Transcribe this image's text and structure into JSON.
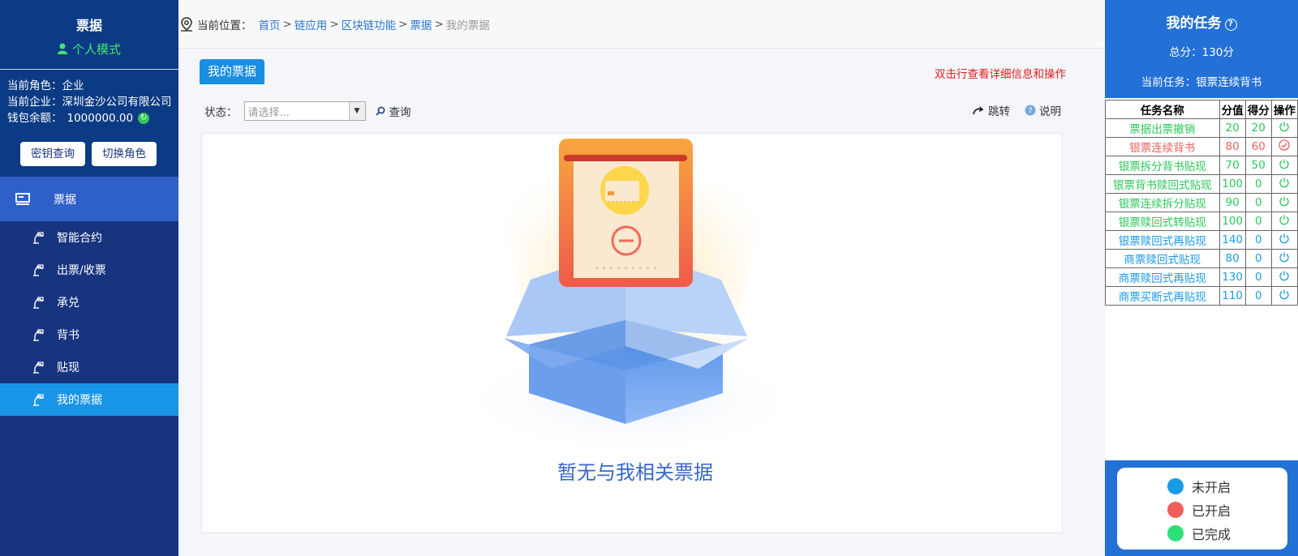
{
  "sidebar": {
    "title": "票据",
    "mode": "个人模式",
    "role_label": "当前角色：",
    "role_value": "企业",
    "company_label": "当前企业：",
    "company_value": "深圳金沙公司有限公司",
    "wallet_label": "钱包余额：",
    "wallet_value": "1000000.00",
    "key_button": "密钥查询",
    "switch_button": "切换角色",
    "menu_head": "票据",
    "items": [
      {
        "label": "智能合约",
        "active": false
      },
      {
        "label": "出票/收票",
        "active": false
      },
      {
        "label": "承兑",
        "active": false
      },
      {
        "label": "背书",
        "active": false
      },
      {
        "label": "贴现",
        "active": false
      },
      {
        "label": "我的票据",
        "active": true
      }
    ]
  },
  "breadcrumb": {
    "label": "当前位置：",
    "links": [
      "首页",
      "链应用",
      "区块链功能",
      "票据"
    ],
    "current": "我的票据"
  },
  "content": {
    "tab": "我的票据",
    "hint": "双击行查看详细信息和操作",
    "status_label": "状态：",
    "status_placeholder": "请选择...",
    "query_label": "查询",
    "jump_label": "跳转",
    "help_label": "说明",
    "empty_text": "暂无与我相关票据"
  },
  "tasks": {
    "title": "我的任务",
    "score": "总分：130分",
    "current": "当前任务：银票连续背书",
    "headers": [
      "任务名称",
      "分值",
      "得分",
      "操作"
    ],
    "rows": [
      {
        "name": "票据出票撤销",
        "value": "20",
        "score": "20",
        "status": "done"
      },
      {
        "name": "银票连续背书",
        "value": "80",
        "score": "60",
        "status": "started"
      },
      {
        "name": "银票拆分背书贴现",
        "value": "70",
        "score": "50",
        "status": "done"
      },
      {
        "name": "银票背书赎回式贴现",
        "value": "100",
        "score": "0",
        "status": "done"
      },
      {
        "name": "银票连续拆分贴现",
        "value": "90",
        "score": "0",
        "status": "done"
      },
      {
        "name": "银票赎回式转贴现",
        "value": "100",
        "score": "0",
        "status": "done"
      },
      {
        "name": "银票赎回式再贴现",
        "value": "140",
        "score": "0",
        "status": "not-started"
      },
      {
        "name": "商票赎回式贴现",
        "value": "80",
        "score": "0",
        "status": "not-started"
      },
      {
        "name": "商票赎回式再贴现",
        "value": "130",
        "score": "0",
        "status": "not-started"
      },
      {
        "name": "商票买断式再贴现",
        "value": "110",
        "score": "0",
        "status": "not-started"
      }
    ],
    "legend": [
      {
        "label": "未开启",
        "color": "#1a9be8"
      },
      {
        "label": "已开启",
        "color": "#f0605a"
      },
      {
        "label": "已完成",
        "color": "#2ee07a"
      }
    ]
  },
  "colors": {
    "not-started": "#1a9be8",
    "started": "#f0605a",
    "done": "#2cc85a"
  }
}
